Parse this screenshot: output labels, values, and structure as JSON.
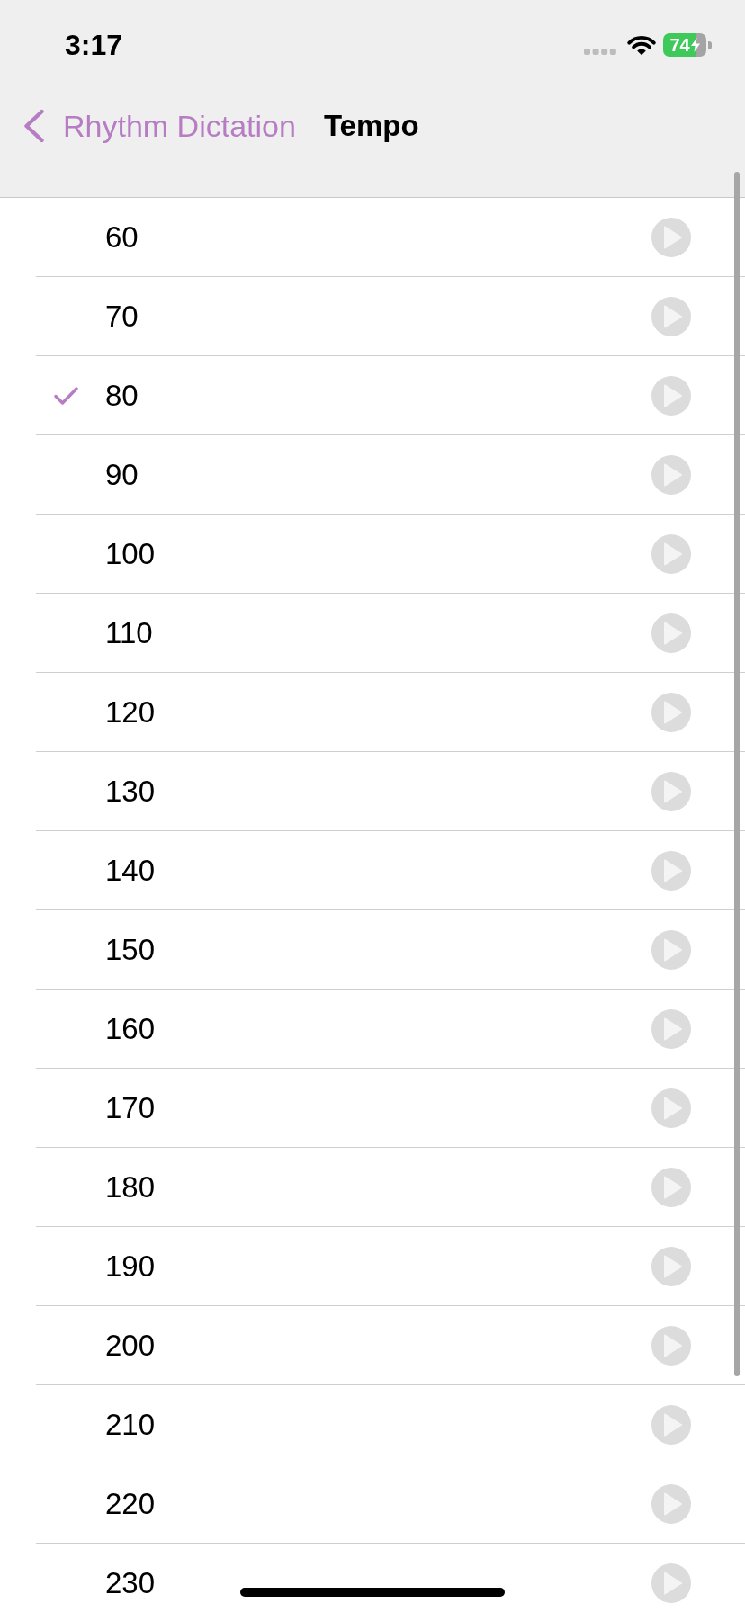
{
  "status_bar": {
    "time": "3:17",
    "battery": "74",
    "charging": true
  },
  "nav_bar": {
    "back_label": "Rhythm Dictation",
    "title": "Tempo"
  },
  "tempos": [
    {
      "value": "60",
      "selected": false
    },
    {
      "value": "70",
      "selected": false
    },
    {
      "value": "80",
      "selected": true
    },
    {
      "value": "90",
      "selected": false
    },
    {
      "value": "100",
      "selected": false
    },
    {
      "value": "110",
      "selected": false
    },
    {
      "value": "120",
      "selected": false
    },
    {
      "value": "130",
      "selected": false
    },
    {
      "value": "140",
      "selected": false
    },
    {
      "value": "150",
      "selected": false
    },
    {
      "value": "160",
      "selected": false
    },
    {
      "value": "170",
      "selected": false
    },
    {
      "value": "180",
      "selected": false
    },
    {
      "value": "190",
      "selected": false
    },
    {
      "value": "200",
      "selected": false
    },
    {
      "value": "210",
      "selected": false
    },
    {
      "value": "220",
      "selected": false
    },
    {
      "value": "230",
      "selected": false
    }
  ]
}
